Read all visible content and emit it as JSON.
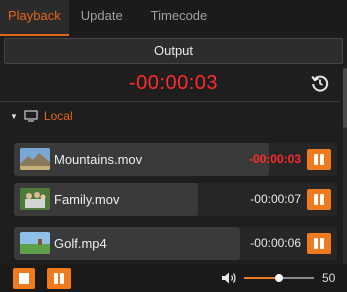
{
  "tabs": [
    {
      "label": "Playback",
      "active": true
    },
    {
      "label": "Update",
      "active": false
    },
    {
      "label": "Timecode",
      "active": false
    }
  ],
  "output": {
    "label": "Output"
  },
  "timer": {
    "value": "-00:00:03",
    "color": "#ff2a2a"
  },
  "icons": {
    "reset": "reset-clock-icon",
    "monitor": "monitor-icon",
    "volume": "speaker-icon"
  },
  "local": {
    "label": "Local"
  },
  "clips": [
    {
      "name": "Mountains.mov",
      "time": "-00:00:03",
      "playing": true,
      "progress": 0.79
    },
    {
      "name": "Family.mov",
      "time": "-00:00:07",
      "playing": false,
      "progress": 0.57
    },
    {
      "name": "Golf.mp4",
      "time": "-00:00:06",
      "playing": false,
      "progress": 0.7
    }
  ],
  "footer": {
    "volume": 50,
    "volume_label": "50"
  },
  "colors": {
    "accent": "#f07a1e",
    "live": "#ff2a2a",
    "tab_active": "#e2651a"
  }
}
